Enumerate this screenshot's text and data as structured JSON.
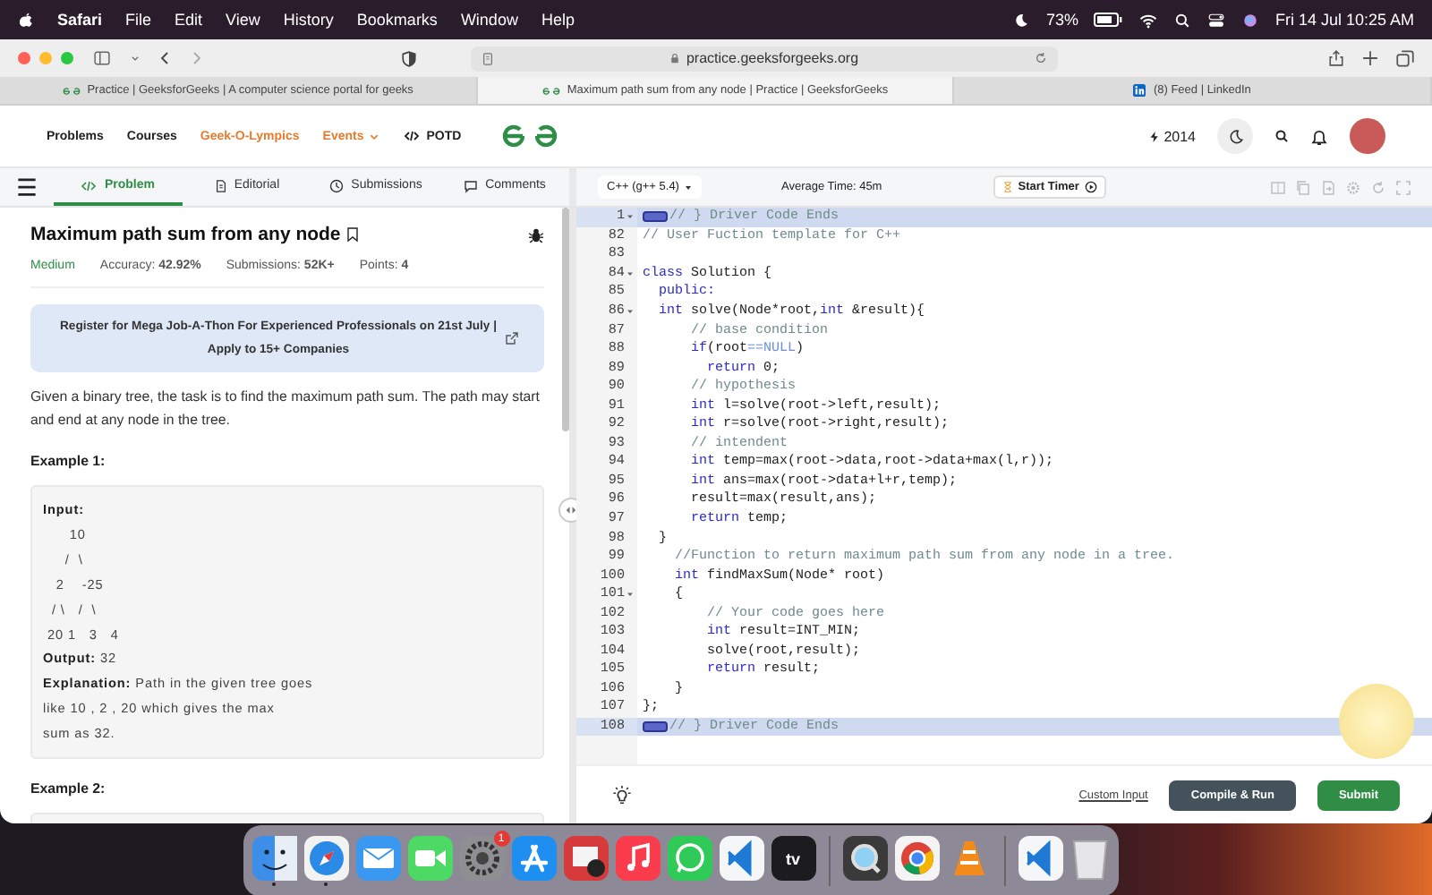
{
  "menubar": {
    "app": "Safari",
    "menus": [
      "File",
      "Edit",
      "View",
      "History",
      "Bookmarks",
      "Window",
      "Help"
    ],
    "battery": "73%",
    "clock": "Fri 14 Jul  10:25 AM"
  },
  "browser": {
    "url": "practice.geeksforgeeks.org",
    "tabs": [
      {
        "label": "Practice | GeeksforGeeks | A computer science portal for geeks",
        "kind": "gfg",
        "selected": false
      },
      {
        "label": "Maximum path sum from any node | Practice | GeeksforGeeks",
        "kind": "gfg",
        "selected": true
      },
      {
        "label": "(8) Feed | LinkedIn",
        "kind": "linkedin",
        "selected": false
      }
    ]
  },
  "site_header": {
    "nav": [
      {
        "label": "Problems",
        "kind": "plain",
        "highlight": false,
        "dropdown": false
      },
      {
        "label": "Courses",
        "kind": "plain",
        "highlight": false,
        "dropdown": false
      },
      {
        "label": "Geek-O-Lympics",
        "kind": "plain",
        "highlight": true,
        "dropdown": false
      },
      {
        "label": "Events",
        "kind": "plain",
        "highlight": true,
        "dropdown": true
      },
      {
        "label": "POTD",
        "kind": "code",
        "highlight": false,
        "dropdown": false
      }
    ],
    "streak": "2014"
  },
  "problem_tabs": [
    {
      "label": "Problem",
      "kind": "code",
      "selected": true
    },
    {
      "label": "Editorial",
      "kind": "document",
      "selected": false
    },
    {
      "label": "Submissions",
      "kind": "clock",
      "selected": false
    },
    {
      "label": "Comments",
      "kind": "comment",
      "selected": false
    }
  ],
  "editor_toolbar": {
    "language": "C++ (g++ 5.4)",
    "average_time": "Average Time: 45m",
    "timer_button": "Start Timer"
  },
  "problem": {
    "title": "Maximum path sum from any node",
    "difficulty": "Medium",
    "stats": [
      "Accuracy: **42.92%**",
      "Submissions: **52K+**",
      "Points: **4**"
    ],
    "banner": "Register for Mega Job-A-Thon For Experienced Professionals on 21st July | Apply to 15+ Companies",
    "description": "Given a binary tree, the task is to find the maximum path sum. The path may start and end at any node in the tree.",
    "examples": [
      {
        "heading": "Example 1:",
        "lines": [
          "**Input:**",
          "      10",
          "     /  \\",
          "   2    -25",
          "  / \\   /  \\",
          " 20 1   3   4",
          "**Output:** 32",
          "**Explanation:** Path in the given tree goes",
          "like 10 , 2 , 20 which gives the max",
          "sum as 32."
        ]
      },
      {
        "heading": "Example 2:"
      }
    ]
  },
  "code": {
    "lines": [
      {
        "number": "1",
        "foldable": true,
        "folded": true,
        "highlighted": true,
        "tokens": [
          {
            "kind": "comment",
            "text": "// } Driver Code Ends"
          }
        ]
      },
      {
        "number": "82",
        "foldable": false,
        "folded": false,
        "highlighted": false,
        "tokens": [
          {
            "kind": "comment",
            "text": "// User Fuction template for C++"
          }
        ]
      },
      {
        "number": "83",
        "foldable": false,
        "folded": false,
        "highlighted": false
      },
      {
        "number": "84",
        "foldable": true,
        "folded": false,
        "highlighted": false,
        "tokens": [
          {
            "kind": "keyword",
            "text": "class"
          },
          {
            "kind": "text",
            "text": " Solution {"
          }
        ]
      },
      {
        "number": "85",
        "foldable": false,
        "folded": false,
        "highlighted": false,
        "tokens": [
          {
            "kind": "keyword",
            "text": "  public:"
          }
        ]
      },
      {
        "number": "86",
        "foldable": true,
        "folded": false,
        "highlighted": false,
        "tokens": [
          {
            "kind": "keyword",
            "text": "  int"
          },
          {
            "kind": "text",
            "text": " solve(Node*root,"
          },
          {
            "kind": "keyword",
            "text": "int"
          },
          {
            "kind": "text",
            "text": " &result){"
          }
        ]
      },
      {
        "number": "87",
        "foldable": false,
        "folded": false,
        "highlighted": false,
        "tokens": [
          {
            "kind": "comment",
            "text": "      // base condition"
          }
        ]
      },
      {
        "number": "88",
        "foldable": false,
        "folded": false,
        "highlighted": false,
        "tokens": [
          {
            "kind": "keyword",
            "text": "      if"
          },
          {
            "kind": "text",
            "text": "(root"
          },
          {
            "kind": "constant",
            "text": "==NULL"
          },
          {
            "kind": "text",
            "text": ")"
          }
        ]
      },
      {
        "number": "89",
        "foldable": false,
        "folded": false,
        "highlighted": false,
        "tokens": [
          {
            "kind": "keyword",
            "text": "        return"
          },
          {
            "kind": "text",
            "text": " 0;"
          }
        ]
      },
      {
        "number": "90",
        "foldable": false,
        "folded": false,
        "highlighted": false,
        "tokens": [
          {
            "kind": "comment",
            "text": "      // hypothesis"
          }
        ]
      },
      {
        "number": "91",
        "foldable": false,
        "folded": false,
        "highlighted": false,
        "tokens": [
          {
            "kind": "keyword",
            "text": "      int"
          },
          {
            "kind": "text",
            "text": " l=solve(root->left,result);"
          }
        ]
      },
      {
        "number": "92",
        "foldable": false,
        "folded": false,
        "highlighted": false,
        "tokens": [
          {
            "kind": "keyword",
            "text": "      int"
          },
          {
            "kind": "text",
            "text": " r=solve(root->right,result);"
          }
        ]
      },
      {
        "number": "93",
        "foldable": false,
        "folded": false,
        "highlighted": false,
        "tokens": [
          {
            "kind": "comment",
            "text": "      // intendent"
          }
        ]
      },
      {
        "number": "94",
        "foldable": false,
        "folded": false,
        "highlighted": false,
        "tokens": [
          {
            "kind": "keyword",
            "text": "      int"
          },
          {
            "kind": "text",
            "text": " temp=max(root->data,root->data+max(l,r));"
          }
        ]
      },
      {
        "number": "95",
        "foldable": false,
        "folded": false,
        "highlighted": false,
        "tokens": [
          {
            "kind": "keyword",
            "text": "      int"
          },
          {
            "kind": "text",
            "text": " ans=max(root->data+l+r,temp);"
          }
        ]
      },
      {
        "number": "96",
        "foldable": false,
        "folded": false,
        "highlighted": false,
        "tokens": [
          {
            "kind": "text",
            "text": "      result=max(result,ans);"
          }
        ]
      },
      {
        "number": "97",
        "foldable": false,
        "folded": false,
        "highlighted": false,
        "tokens": [
          {
            "kind": "keyword",
            "text": "      return"
          },
          {
            "kind": "text",
            "text": " temp;"
          }
        ]
      },
      {
        "number": "98",
        "foldable": false,
        "folded": false,
        "highlighted": false,
        "tokens": [
          {
            "kind": "text",
            "text": "  }"
          }
        ]
      },
      {
        "number": "99",
        "foldable": false,
        "folded": false,
        "highlighted": false,
        "tokens": [
          {
            "kind": "comment",
            "text": "    //Function to return maximum path sum from any node in a tree."
          }
        ]
      },
      {
        "number": "100",
        "foldable": false,
        "folded": false,
        "highlighted": false,
        "tokens": [
          {
            "kind": "keyword",
            "text": "    int"
          },
          {
            "kind": "text",
            "text": " findMaxSum(Node* root)"
          }
        ]
      },
      {
        "number": "101",
        "foldable": true,
        "folded": false,
        "highlighted": false,
        "tokens": [
          {
            "kind": "text",
            "text": "    {"
          }
        ]
      },
      {
        "number": "102",
        "foldable": false,
        "folded": false,
        "highlighted": false,
        "tokens": [
          {
            "kind": "comment",
            "text": "        // Your code goes here"
          }
        ]
      },
      {
        "number": "103",
        "foldable": false,
        "folded": false,
        "highlighted": false,
        "tokens": [
          {
            "kind": "keyword",
            "text": "        int"
          },
          {
            "kind": "text",
            "text": " result=INT_MIN;"
          }
        ]
      },
      {
        "number": "104",
        "foldable": false,
        "folded": false,
        "highlighted": false,
        "tokens": [
          {
            "kind": "text",
            "text": "        solve(root,result);"
          }
        ]
      },
      {
        "number": "105",
        "foldable": false,
        "folded": false,
        "highlighted": false,
        "tokens": [
          {
            "kind": "keyword",
            "text": "        return"
          },
          {
            "kind": "text",
            "text": " result;"
          }
        ]
      },
      {
        "number": "106",
        "foldable": false,
        "folded": false,
        "highlighted": false,
        "tokens": [
          {
            "kind": "text",
            "text": "    }"
          }
        ]
      },
      {
        "number": "107",
        "foldable": false,
        "folded": false,
        "highlighted": false,
        "tokens": [
          {
            "kind": "text",
            "text": "};"
          }
        ]
      },
      {
        "number": "108",
        "foldable": false,
        "folded": true,
        "highlighted": true,
        "tokens": [
          {
            "kind": "comment",
            "text": "// } Driver Code Ends"
          }
        ]
      }
    ]
  },
  "editor_footer": {
    "custom_input": "Custom Input",
    "run_button": "Compile & Run",
    "submit_button": "Submit"
  },
  "dock": [
    {
      "apps": [
        {
          "kind": "finder",
          "running": true
        },
        {
          "kind": "safari",
          "running": true
        },
        {
          "kind": "mail",
          "running": false
        },
        {
          "kind": "facetime",
          "running": false
        },
        {
          "kind": "settings",
          "running": false,
          "badge": "1"
        },
        {
          "kind": "appstore",
          "running": false
        },
        {
          "kind": "photobooth",
          "running": false
        },
        {
          "kind": "music",
          "running": false
        },
        {
          "kind": "whatsapp",
          "running": false
        },
        {
          "kind": "vscode",
          "running": false
        },
        {
          "kind": "tv",
          "running": false,
          "label": "tv"
        }
      ]
    },
    {
      "apps": [
        {
          "kind": "quicktime",
          "running": false
        },
        {
          "kind": "chrome",
          "running": false
        },
        {
          "kind": "vlc",
          "running": false
        }
      ]
    },
    {
      "apps": [
        {
          "kind": "vscode",
          "running": false
        },
        {
          "kind": "trash",
          "running": false
        }
      ]
    }
  ]
}
